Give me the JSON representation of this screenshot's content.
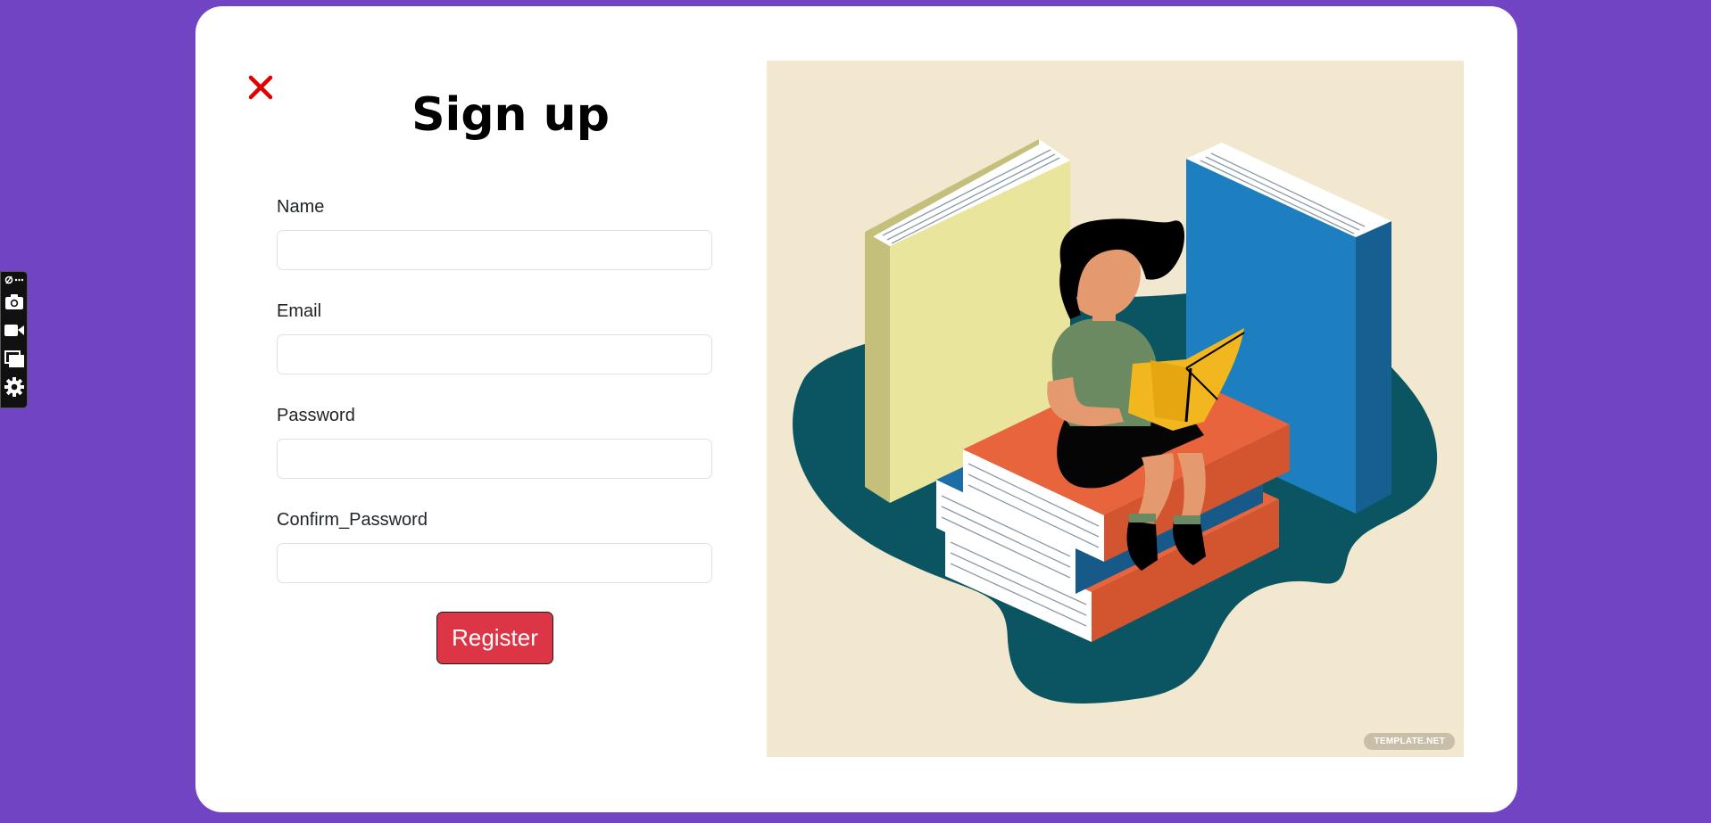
{
  "form": {
    "title": "Sign up",
    "fields": [
      {
        "label": "Name",
        "value": "",
        "placeholder": ""
      },
      {
        "label": "Email",
        "value": "",
        "placeholder": ""
      },
      {
        "label": "Password",
        "value": "",
        "placeholder": ""
      },
      {
        "label": "Confirm_Password",
        "value": "",
        "placeholder": ""
      }
    ],
    "register_label": "Register"
  },
  "illustration": {
    "watermark": "TEMPLATE.NET"
  },
  "toolbar": {
    "items": [
      "pin-more-icon",
      "camera-icon",
      "video-icon",
      "windows-icon",
      "gear-icon"
    ]
  },
  "colors": {
    "background": "#7044c2",
    "card": "#ffffff",
    "close": "#e00000",
    "register": "#dc3545",
    "illustration_bg": "#f2e8cf"
  }
}
